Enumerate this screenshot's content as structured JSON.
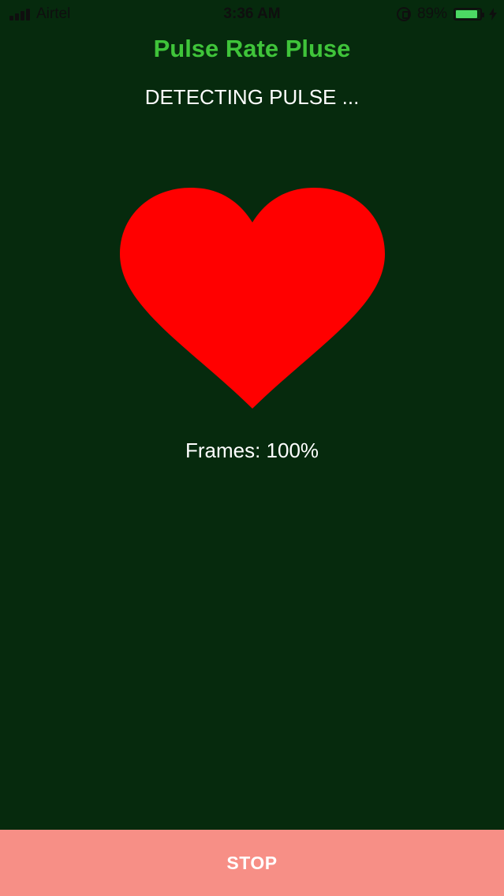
{
  "status_bar": {
    "carrier": "Airtel",
    "time": "3:36 AM",
    "battery_percent": "89%",
    "battery_level": 0.89,
    "signal_icon": "signal-bars-icon",
    "lock_icon": "orientation-lock-icon",
    "battery_icon": "battery-icon",
    "charging_icon": "charging-bolt-icon"
  },
  "header": {
    "title": "Pulse Rate Pluse",
    "status": "DETECTING PULSE ..."
  },
  "heart": {
    "icon": "heart-icon",
    "color": "#ff0000"
  },
  "frames": {
    "label": "Frames: 100%"
  },
  "footer": {
    "stop_label": "STOP"
  },
  "colors": {
    "background": "#062a0d",
    "title": "#3fc43a",
    "stop_button": "#f78f86"
  }
}
